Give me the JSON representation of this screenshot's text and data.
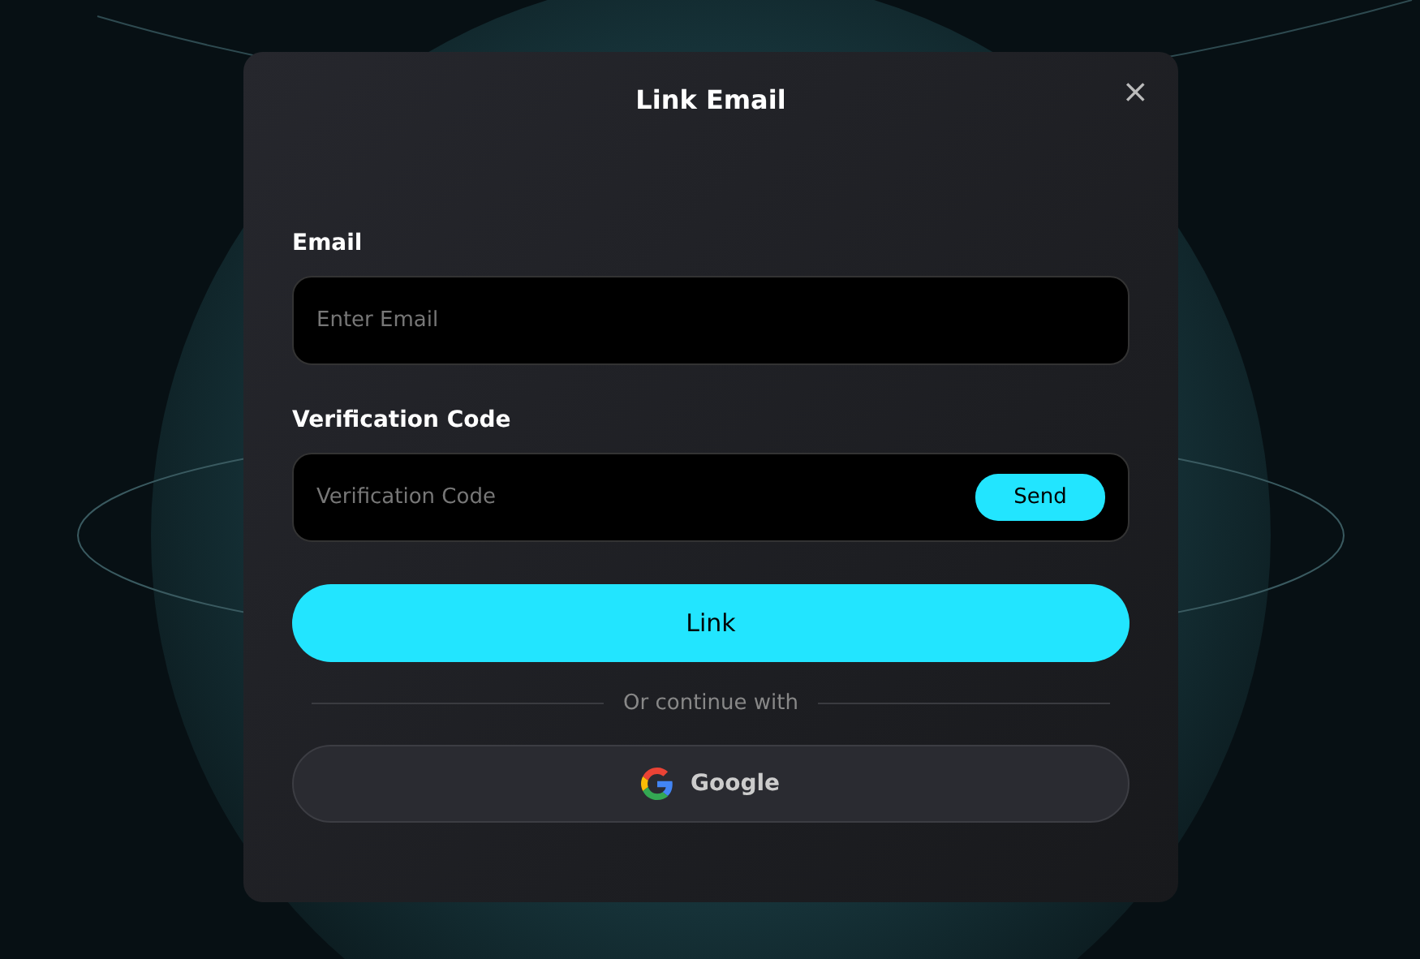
{
  "dialog": {
    "title": "Link Email",
    "close": "×"
  },
  "fields": [
    {
      "label": "Email",
      "placeholder": "Enter Email"
    },
    {
      "label": "Verification Code",
      "placeholder": "Verification Code",
      "action": "Send"
    }
  ],
  "primary_button": "Link",
  "divider": "Or continue with",
  "social_button": "Google"
}
